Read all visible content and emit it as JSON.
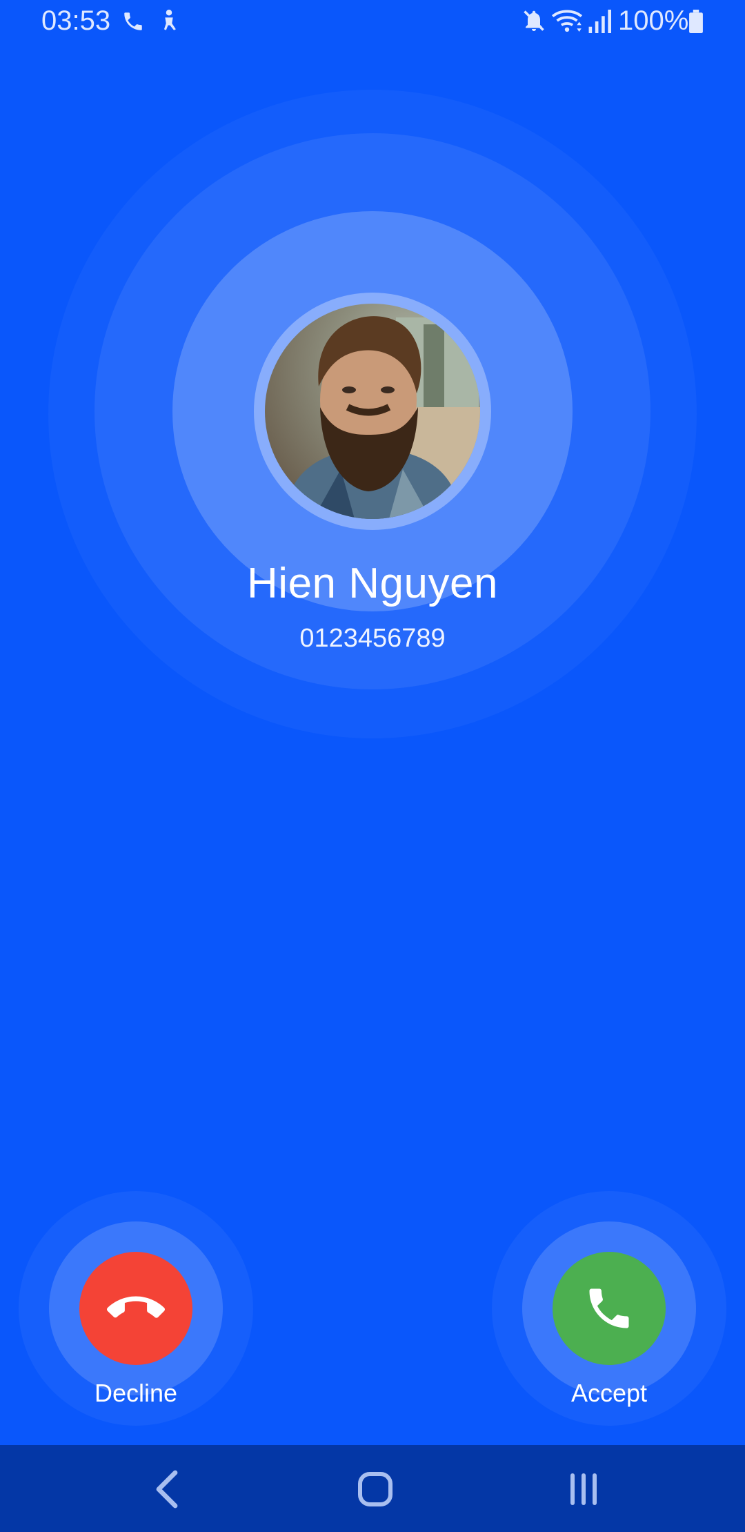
{
  "status_bar": {
    "time": "03:53",
    "battery_text": "100%",
    "icons": [
      "phone-call-icon",
      "accessibility-icon",
      "mute-icon",
      "wifi-icon",
      "signal-icon",
      "battery-icon"
    ]
  },
  "caller": {
    "name": "Hien Nguyen",
    "number": "0123456789",
    "avatar": "caller-photo"
  },
  "actions": {
    "decline": {
      "label": "Decline",
      "color": "#F44336",
      "icon": "phone-hangup-icon"
    },
    "accept": {
      "label": "Accept",
      "color": "#4CAF50",
      "icon": "phone-icon"
    }
  },
  "nav": {
    "items": [
      "back-icon",
      "home-icon",
      "recents-icon"
    ]
  },
  "colors": {
    "background": "#0A57FB",
    "nav_background": "#0437A6"
  }
}
